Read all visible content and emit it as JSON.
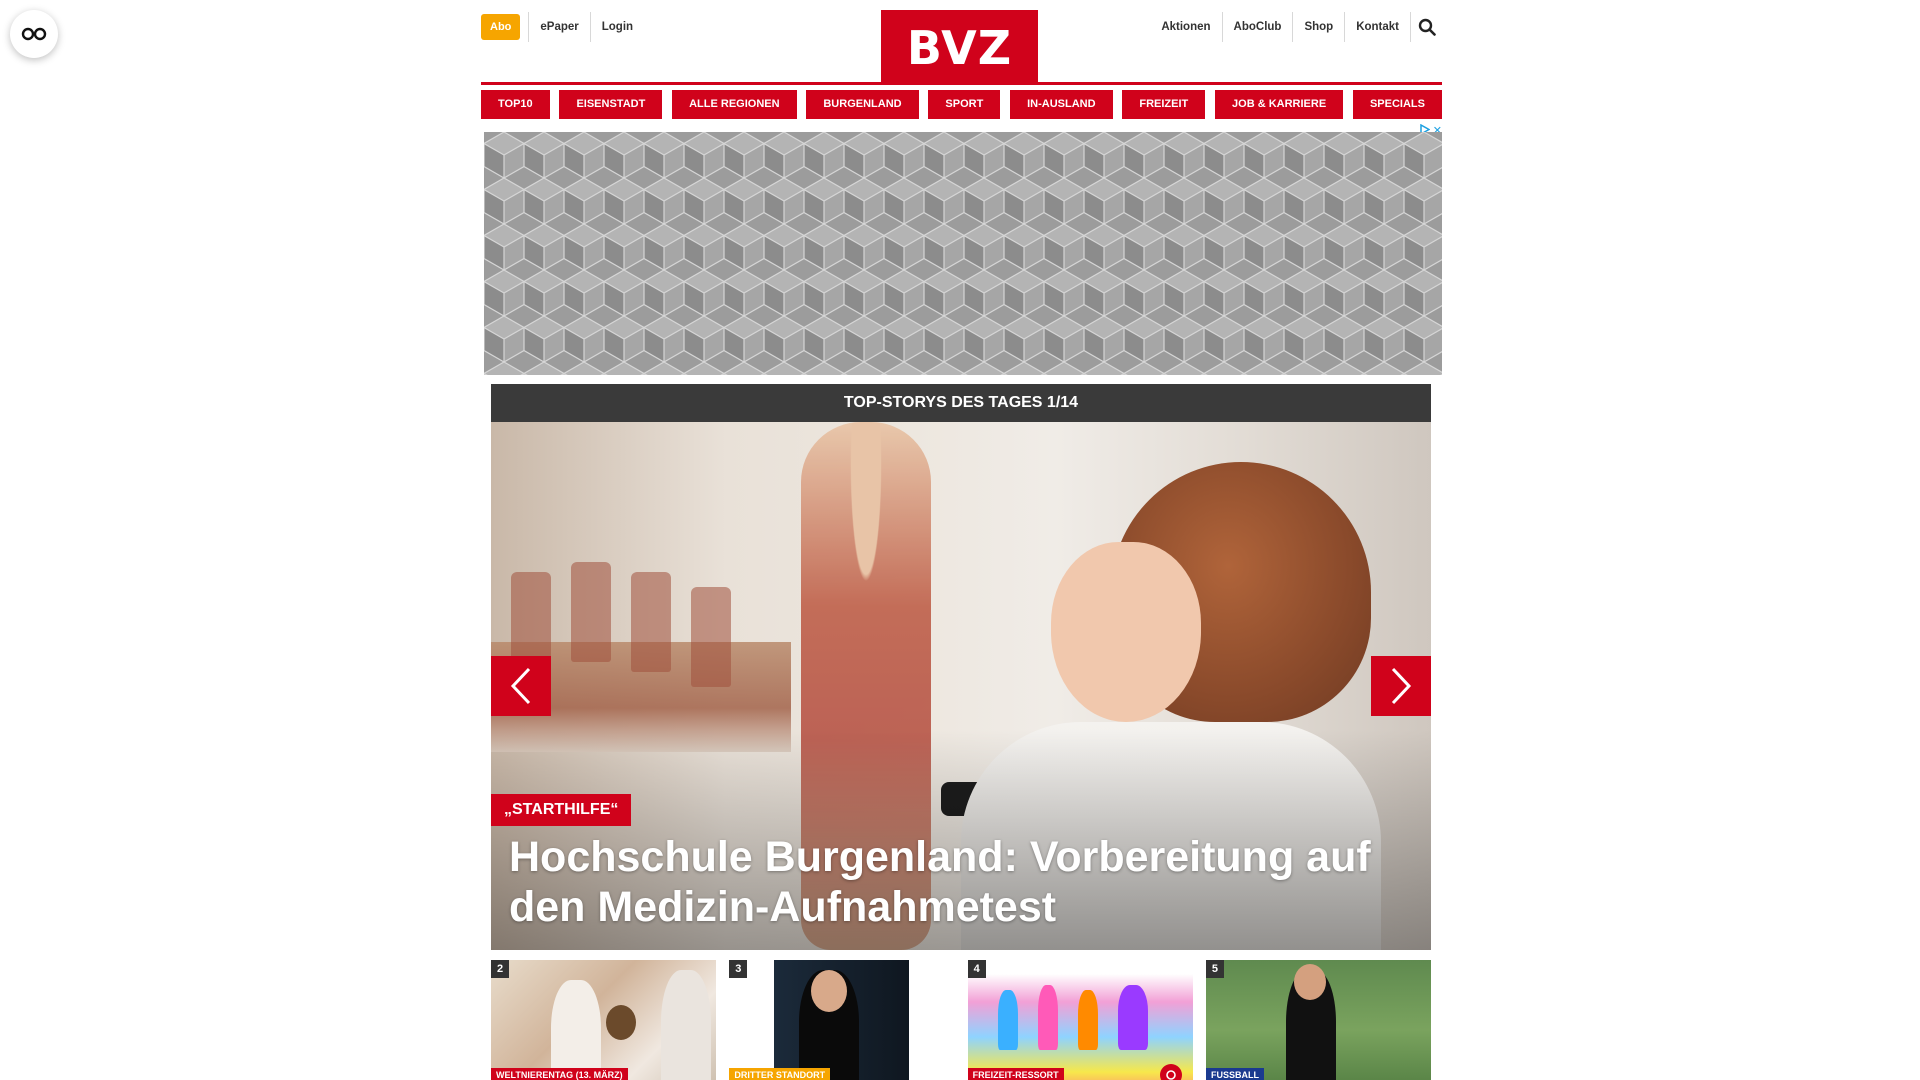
{
  "header": {
    "abo_label": "Abo",
    "epaper_label": "ePaper",
    "login_label": "Login",
    "logo_text": "BVZ",
    "right_links": [
      "Aktionen",
      "AboClub",
      "Shop",
      "Kontakt"
    ]
  },
  "nav": {
    "items": [
      "TOP10",
      "EISENSTADT",
      "ALLE REGIONEN",
      "BURGENLAND",
      "SPORT",
      "IN-AUSLAND",
      "FREIZEIT",
      "JOB & KARRIERE",
      "SPECIALS"
    ]
  },
  "ad": {
    "choices_icon": "adchoices-icon",
    "close_label": "✕"
  },
  "top_stories": {
    "heading": "TOP-STORYS DES TAGES 1/14",
    "main": {
      "kicker": "„STARTHILFE“",
      "headline": "Hochschule Burgenland: Vorbereitung auf den Medizin-Aufnahmetest"
    },
    "thumbs": [
      {
        "number": "2",
        "label": "WELTNIERENTAG (13. MÄRZ)",
        "label_color": "#d0021b"
      },
      {
        "number": "3",
        "label": "DRITTER STANDORT",
        "label_color": "#f6a500"
      },
      {
        "number": "4",
        "label": "FREIZEIT-RESSORT",
        "label_color": "#d0021b"
      },
      {
        "number": "5",
        "label": "FUSSBALL",
        "label_color": "#1a3a8f"
      }
    ]
  },
  "colors": {
    "brand_red": "#d0021b",
    "abo_orange": "#f6a500",
    "dark_bar": "#3a3a3a"
  }
}
